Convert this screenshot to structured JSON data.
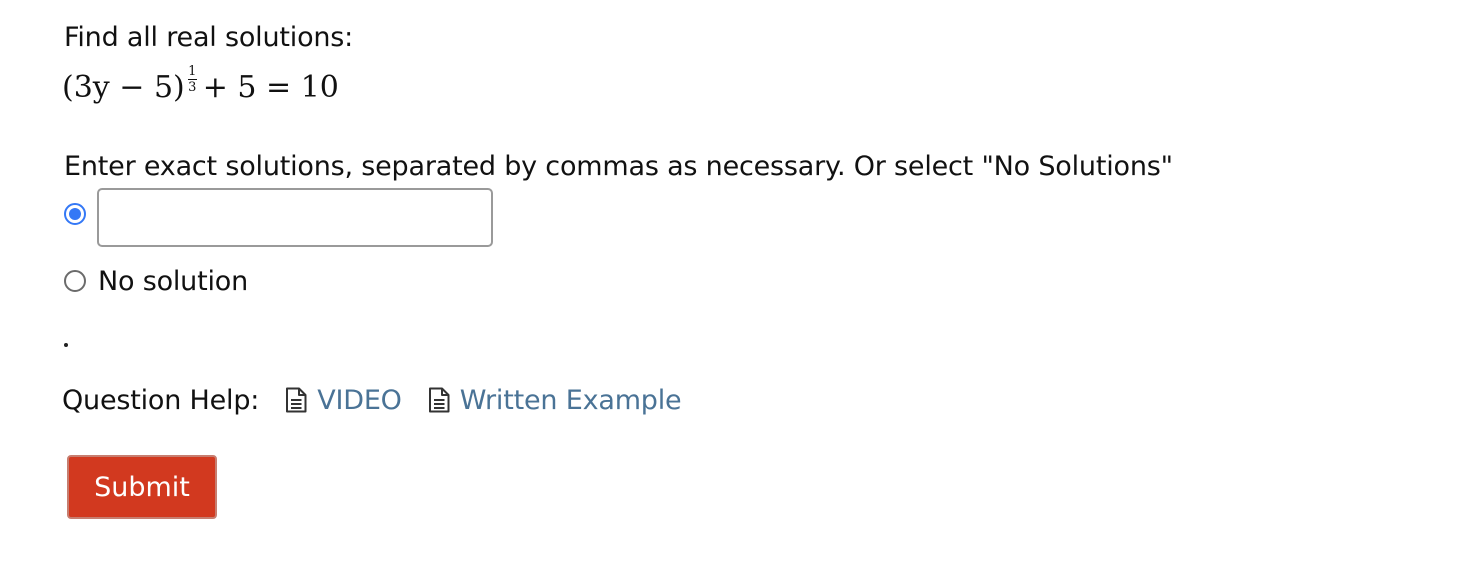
{
  "question": {
    "prompt": "Find all real solutions:",
    "equation": {
      "base": "(3y − 5)",
      "exponent_numerator": "1",
      "exponent_denominator": "3",
      "rest": "+ 5 = 10"
    },
    "instructions": "Enter exact solutions, separated by commas as necessary. Or select \"No Solutions\""
  },
  "answer": {
    "input_value": "",
    "option_selected": "input",
    "no_solution_label": "No solution"
  },
  "help": {
    "label": "Question Help:",
    "links": [
      {
        "label": "VIDEO",
        "icon": "document-icon"
      },
      {
        "label": "Written Example",
        "icon": "document-icon"
      }
    ],
    "link_color": "#4a7396"
  },
  "submit": {
    "label": "Submit",
    "color": "#d2391f"
  },
  "colors": {
    "radio_accent": "#3478f6"
  }
}
